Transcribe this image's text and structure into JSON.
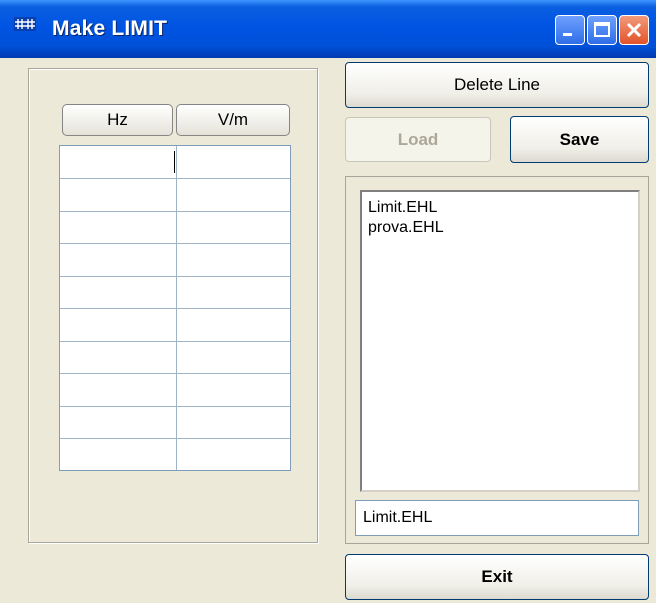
{
  "window": {
    "title": "Make LIMIT"
  },
  "table": {
    "headers": [
      "Hz",
      "V/m"
    ],
    "rows": [
      [
        "",
        ""
      ],
      [
        "",
        ""
      ],
      [
        "",
        ""
      ],
      [
        "",
        ""
      ],
      [
        "",
        ""
      ],
      [
        "",
        ""
      ],
      [
        "",
        ""
      ],
      [
        "",
        ""
      ],
      [
        "",
        ""
      ],
      [
        "",
        ""
      ]
    ]
  },
  "buttons": {
    "delete_line": "Delete Line",
    "load": "Load",
    "save": "Save",
    "exit": "Exit"
  },
  "file_list": {
    "items": [
      "Limit.EHL",
      "prova.EHL"
    ]
  },
  "filename_field": {
    "value": "Limit.EHL"
  },
  "colors": {
    "titlebar": "#0054e3",
    "window_bg": "#ece9d8",
    "close_button": "#e2532a"
  }
}
